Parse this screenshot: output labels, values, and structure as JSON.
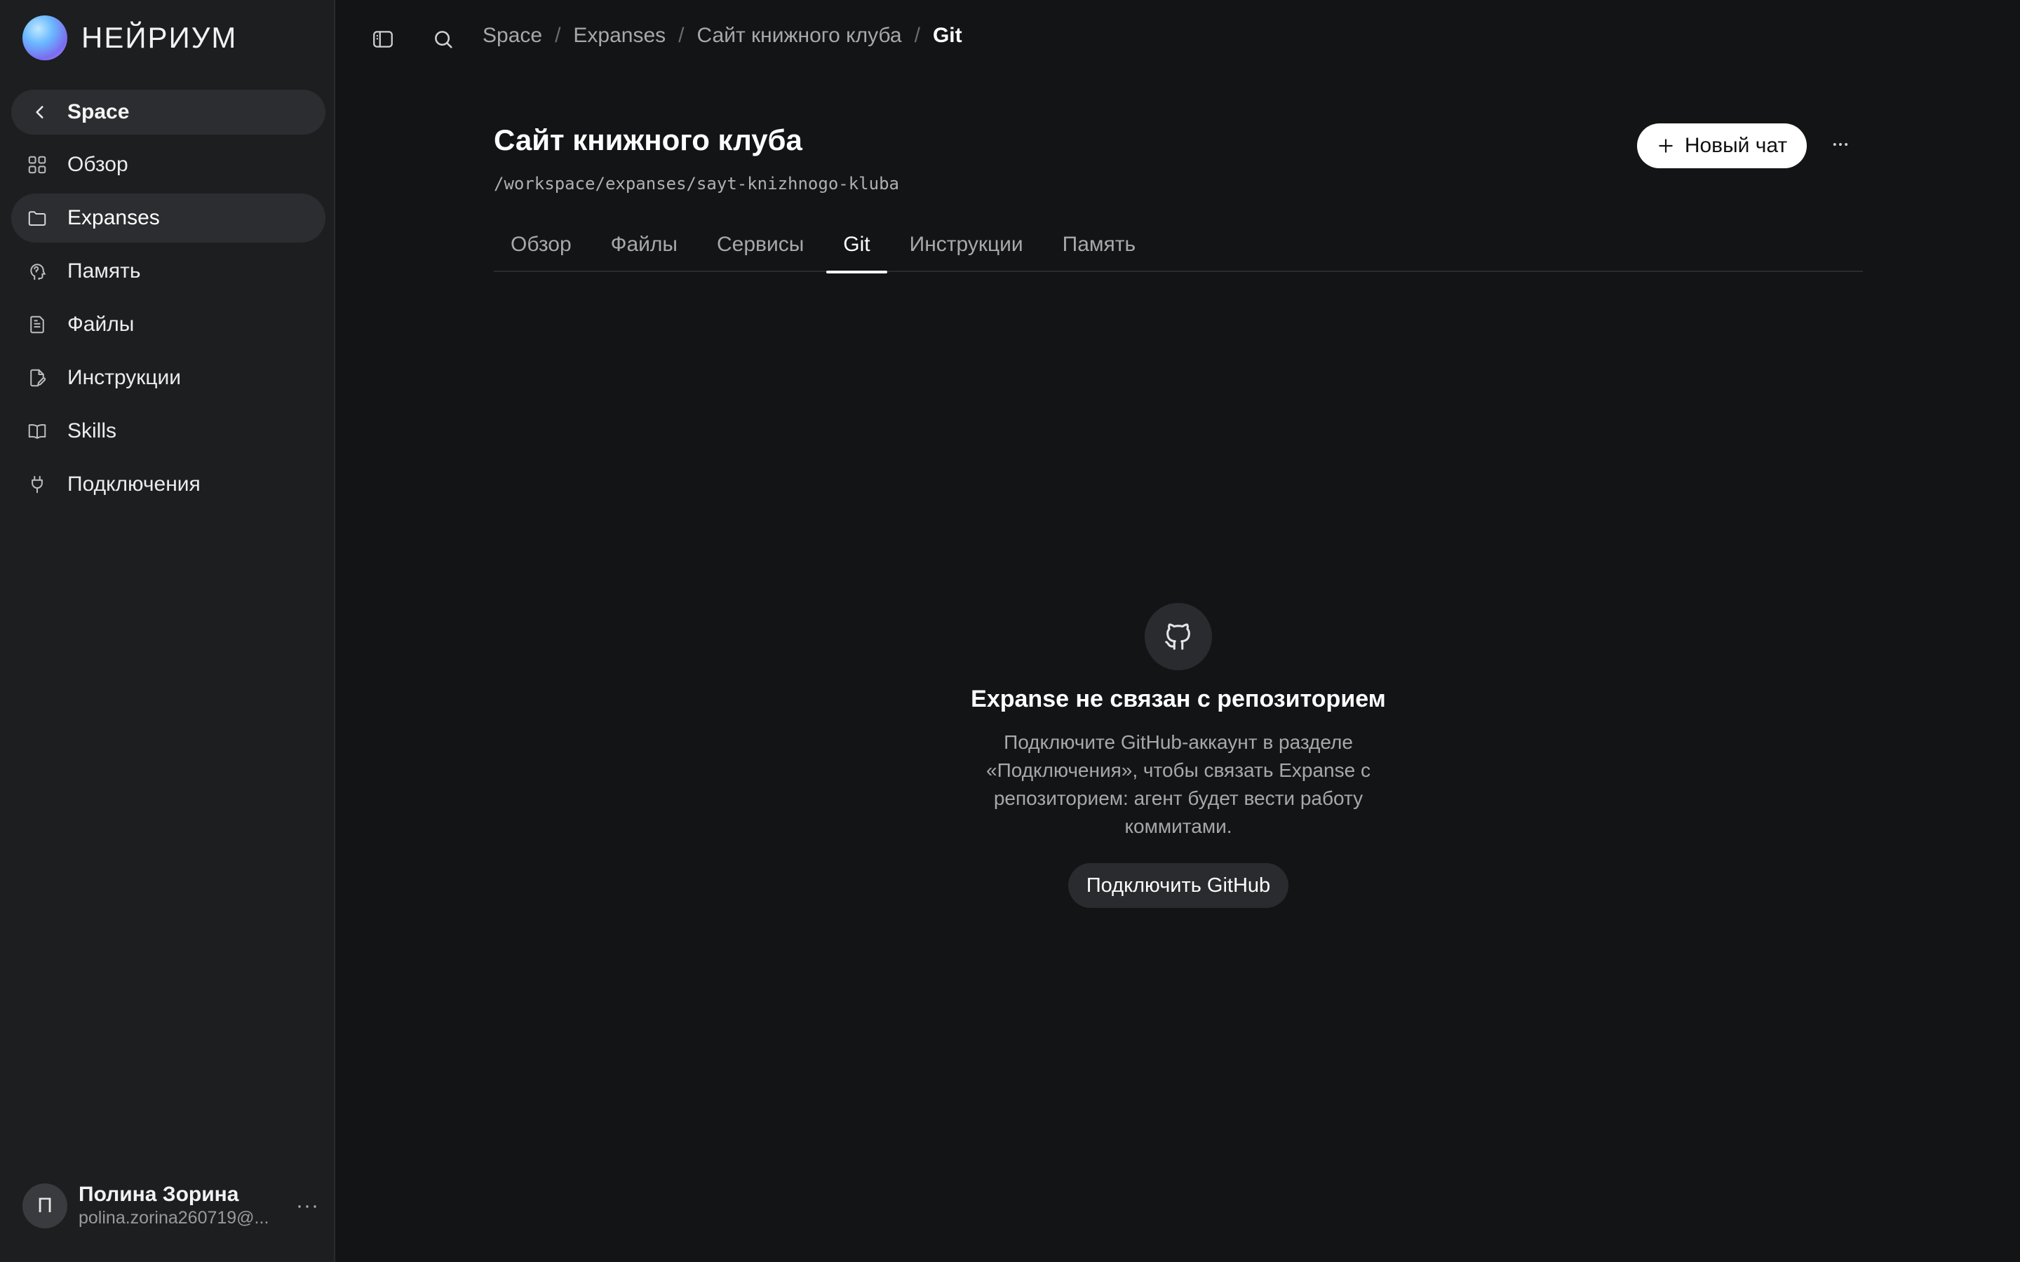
{
  "brand": {
    "name": "НЕЙРИУМ"
  },
  "sidebar": {
    "back_label": "Space",
    "items": [
      {
        "label": "Обзор",
        "icon": "grid-icon"
      },
      {
        "label": "Expanses",
        "icon": "folder-icon",
        "active": true
      },
      {
        "label": "Память",
        "icon": "brain-icon"
      },
      {
        "label": "Файлы",
        "icon": "file-icon"
      },
      {
        "label": "Инструкции",
        "icon": "file-edit-icon"
      },
      {
        "label": "Skills",
        "icon": "book-icon"
      },
      {
        "label": "Подключения",
        "icon": "plug-icon"
      }
    ]
  },
  "user": {
    "initial": "П",
    "name": "Полина Зорина",
    "email": "polina.zorina260719@...",
    "more": "···"
  },
  "breadcrumbs": [
    "Space",
    "Expanses",
    "Сайт книжного клуба",
    "Git"
  ],
  "breadcrumb_sep": "/",
  "header": {
    "title": "Сайт книжного клуба",
    "path": "/workspace/expanses/sayt-knizhnogo-kluba",
    "new_chat_label": "Новый чат",
    "more_label": "···"
  },
  "tabs": [
    {
      "label": "Обзор"
    },
    {
      "label": "Файлы"
    },
    {
      "label": "Сервисы"
    },
    {
      "label": "Git",
      "active": true
    },
    {
      "label": "Инструкции"
    },
    {
      "label": "Память"
    }
  ],
  "empty_state": {
    "icon": "github-icon",
    "title": "Expanse не связан с репозиторием",
    "description": "Подключите GitHub-аккаунт в разделе «Подключения», чтобы связать Expanse с репозиторием: агент будет вести работу коммитами.",
    "button_label": "Подключить GitHub"
  },
  "colors": {
    "background": "#131416",
    "sidebar": "#1d1e20",
    "active_item": "#2c2d30",
    "text_primary": "#ffffff",
    "text_muted": "#a8a8ac"
  }
}
